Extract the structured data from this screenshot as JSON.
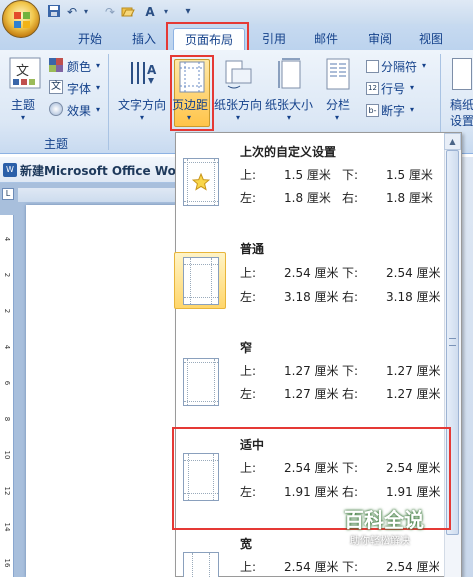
{
  "tabs": [
    {
      "label": "开始"
    },
    {
      "label": "插入"
    },
    {
      "label": "页面布局"
    },
    {
      "label": "引用"
    },
    {
      "label": "邮件"
    },
    {
      "label": "审阅"
    },
    {
      "label": "视图"
    }
  ],
  "ribbon": {
    "theme": {
      "main": "主题",
      "colors": "颜色",
      "fonts": "字体",
      "effects": "效果",
      "group": "主题"
    },
    "text_direction": "文字方向",
    "margins": "页边距",
    "orientation": "纸张方向",
    "size": "纸张大小",
    "columns": "分栏",
    "breaks": "分隔符",
    "line_numbers": "行号",
    "hyphenation": "断字",
    "draft_watermark": "稿纸",
    "draft_settings": "设置"
  },
  "document": {
    "title": "新建Microsoft Office Wo"
  },
  "margin_options": [
    {
      "name": "上次的自定义设置",
      "top_label": "上:",
      "top": "1.5 厘米",
      "bottom_label": "下:",
      "bottom": "1.5 厘米",
      "left_label": "左:",
      "left": "1.8 厘米",
      "right_label": "右:",
      "right": "1.8 厘米"
    },
    {
      "name": "普通",
      "top_label": "上:",
      "top": "2.54 厘米",
      "bottom_label": "下:",
      "bottom": "2.54 厘米",
      "left_label": "左:",
      "left": "3.18 厘米",
      "right_label": "右:",
      "right": "3.18 厘米"
    },
    {
      "name": "窄",
      "top_label": "上:",
      "top": "1.27 厘米",
      "bottom_label": "下:",
      "bottom": "1.27 厘米",
      "left_label": "左:",
      "left": "1.27 厘米",
      "right_label": "右:",
      "right": "1.27 厘米"
    },
    {
      "name": "适中",
      "top_label": "上:",
      "top": "2.54 厘米",
      "bottom_label": "下:",
      "bottom": "2.54 厘米",
      "left_label": "左:",
      "left": "1.91 厘米",
      "right_label": "右:",
      "right": "1.91 厘米"
    },
    {
      "name": "宽",
      "top_label": "上:",
      "top": "2.54 厘米",
      "bottom_label": "下:",
      "bottom": "2.54 厘米"
    }
  ],
  "ruler": {
    "marks": [
      "4",
      "2",
      "2",
      "4",
      "6",
      "8",
      "10",
      "12",
      "14",
      "16"
    ]
  },
  "watermark": {
    "main": "百科全说",
    "sub": "助你轻松解决"
  },
  "colors": {
    "highlight": "#e53935",
    "accent": "#15428b"
  }
}
